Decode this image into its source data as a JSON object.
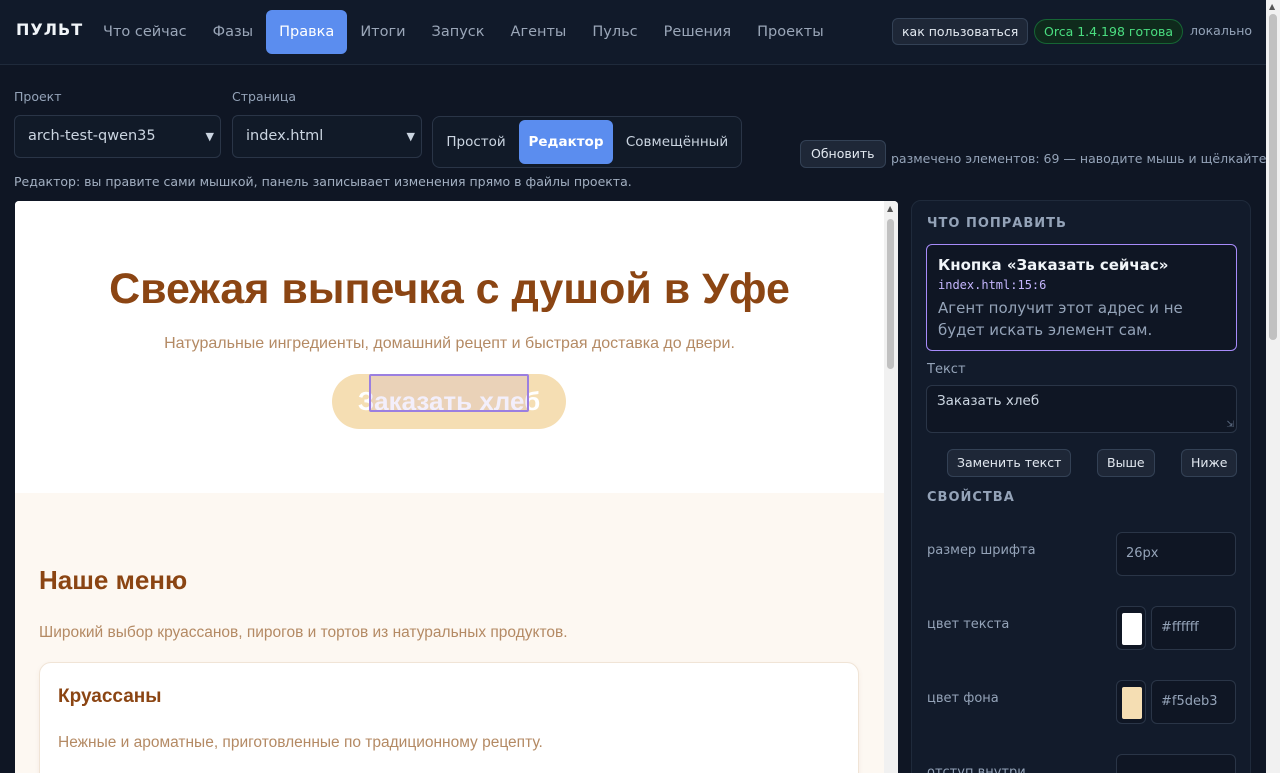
{
  "brand": "ПУЛЬТ",
  "nav": {
    "tabs": [
      "Что сейчас",
      "Фазы",
      "Правка",
      "Итоги",
      "Запуск",
      "Агенты",
      "Пульс",
      "Решения",
      "Проекты"
    ],
    "active_tab": "Правка"
  },
  "header": {
    "howto": "как пользоваться",
    "status": "Orca 1.4.198 готова",
    "mode": "локально"
  },
  "controls": {
    "project_label": "Проект",
    "project_value": "arch-test-qwen35",
    "page_label": "Страница",
    "page_value": "index.html",
    "modes": [
      "Простой",
      "Редактор",
      "Совмещённый"
    ],
    "active_mode": "Редактор",
    "refresh": "Обновить",
    "marked_info": "размечено элементов: 69 — наводите мышь и щёлкайте",
    "hint": "Редактор: вы правите сами мышкой, панель записывает изменения прямо в файлы проекта."
  },
  "preview": {
    "hero_title": "Свежая выпечка с душой в Уфе",
    "hero_sub": "Натуральные ингредиенты, домашний рецепт и быстрая доставка до двери.",
    "cta": "Заказать хлеб",
    "menu_title": "Наше меню",
    "menu_sub": "Широкий выбор круассанов, пирогов и тортов из натуральных продуктов.",
    "card_title": "Круассаны",
    "card_text": "Нежные и ароматные, приготовленные по традиционному рецепту."
  },
  "panel": {
    "title": "ЧТО ПОПРАВИТЬ",
    "selected_title": "Кнопка «Заказать сейчас»",
    "selected_path": "index.html:15:6",
    "selected_desc": "Агент получит этот адрес и не будет искать элемент сам.",
    "text_label": "Текст",
    "text_value": "Заказать хлеб",
    "replace_btn": "Заменить текст",
    "up_btn": "Выше",
    "down_btn": "Ниже",
    "props_title": "СВОЙСТВА",
    "font_size_label": "размер шрифта",
    "font_size_value": "26px",
    "text_color_label": "цвет текста",
    "text_color_value": "#ffffff",
    "bg_color_label": "цвет фона",
    "bg_color_value": "#f5deb3",
    "padding_label": "отступ внутри"
  },
  "colors": {
    "accent": "#5b8def",
    "ready_green": "#4ade80",
    "selection_purple": "#a78bfa",
    "brand_brown": "#8b4513",
    "button_wheat": "#f5deb3"
  },
  "icons": {
    "select_chevron": "chevron-down-icon",
    "resize_grip": "resize-grip-icon",
    "scroll_up": "scroll-up-arrow-icon"
  }
}
